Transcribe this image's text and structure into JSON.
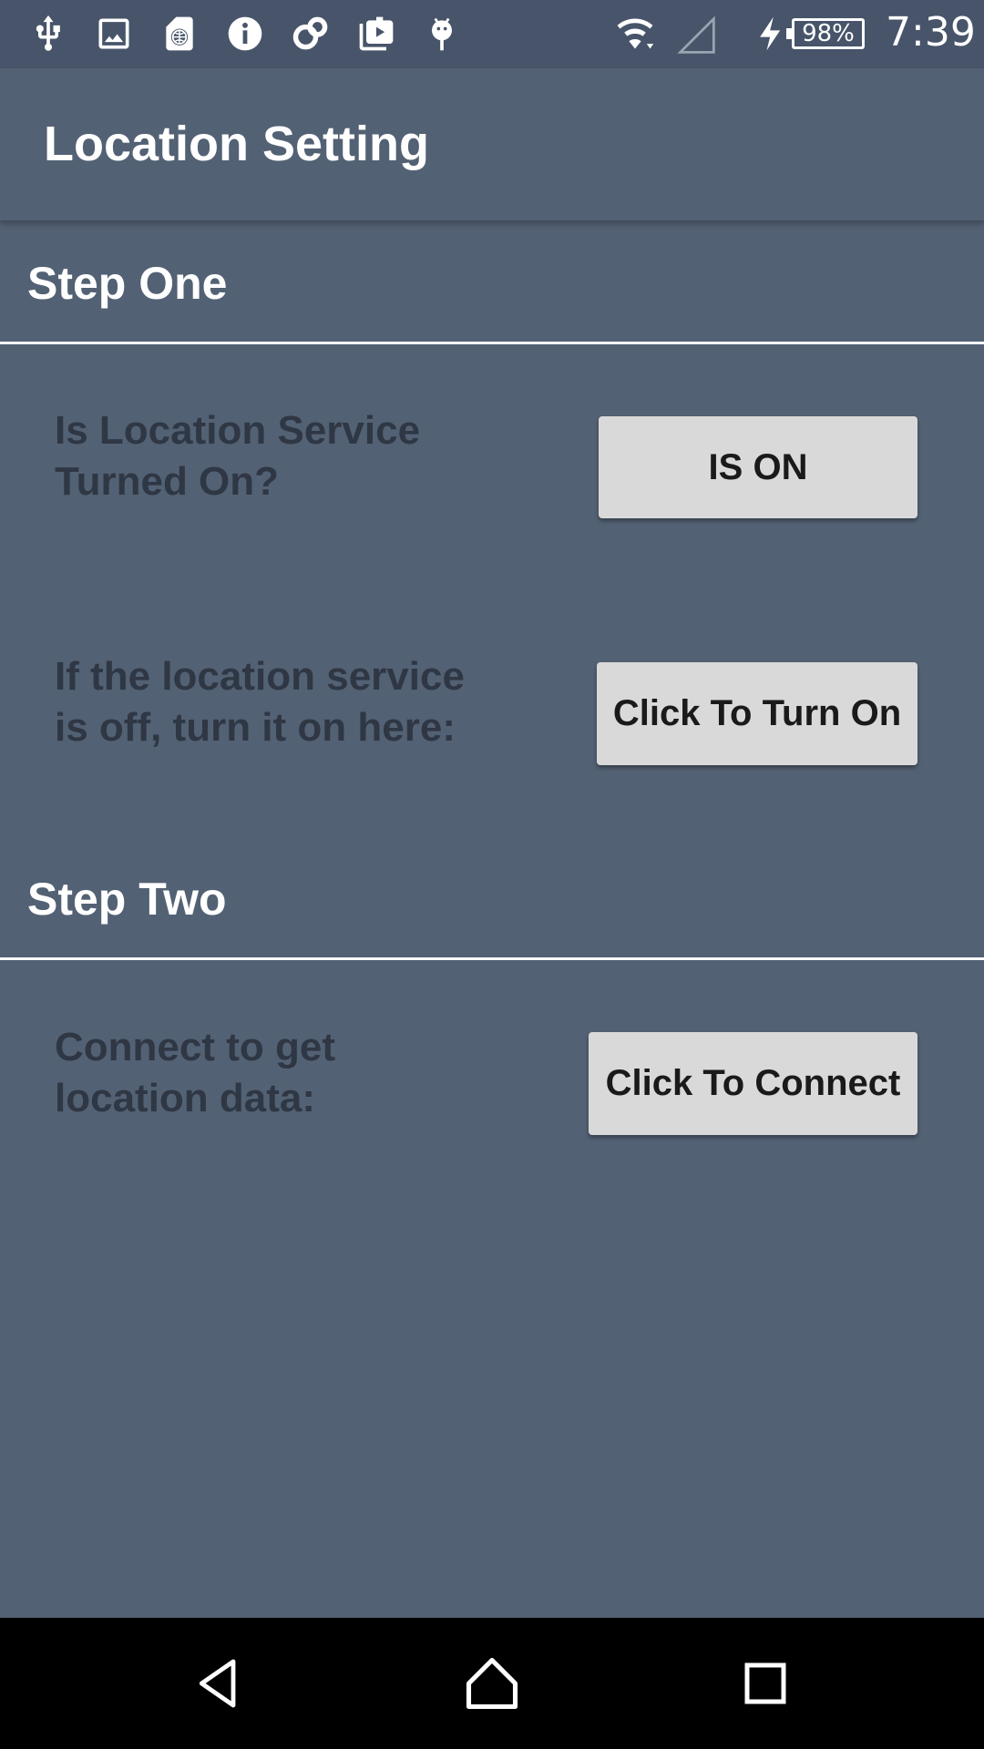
{
  "status_bar": {
    "left_icons": [
      "usb-icon",
      "image-icon",
      "sim-globe-icon",
      "info-icon",
      "link-icon",
      "video-icon",
      "android-icon"
    ],
    "battery": "98%",
    "time": "7:39"
  },
  "app_bar": {
    "title": "Location Setting"
  },
  "step_one": {
    "title": "Step One",
    "rows": [
      {
        "label_line1": "Is Location Service",
        "label_line2": "Turned On?",
        "button": "IS ON"
      },
      {
        "label_line1": "If the location service",
        "label_line2": "is off, turn it on here:",
        "button": "Click To Turn On"
      }
    ]
  },
  "step_two": {
    "title": "Step Two",
    "rows": [
      {
        "label_line1": "Connect to get",
        "label_line2": "location data:",
        "button": "Click To Connect"
      }
    ]
  },
  "nav_bar": {
    "icons": [
      "back-icon",
      "home-icon",
      "recents-icon"
    ]
  },
  "colors": {
    "background": "#536174",
    "status_bar": "#47546a",
    "button": "#d9d9d9",
    "label_text": "#2f3744",
    "nav_bar": "#000000"
  }
}
